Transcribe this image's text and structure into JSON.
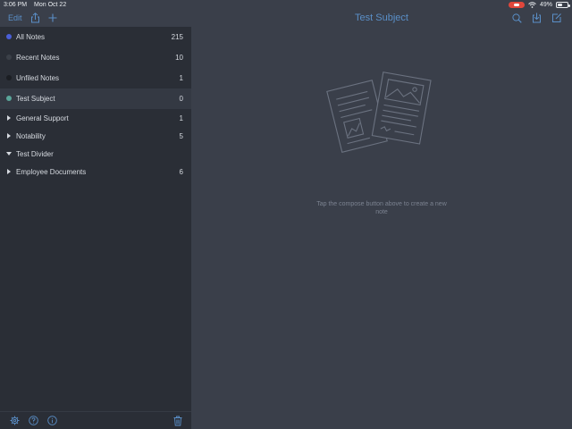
{
  "status_bar": {
    "time": "3:06 PM",
    "date": "Mon Oct 22",
    "battery": "49%",
    "battery_level": 0.49
  },
  "nav": {
    "edit_label": "Edit",
    "title": "Test Subject"
  },
  "sidebar": {
    "items": [
      {
        "label": "All Notes",
        "count": "215",
        "color": "#4a5fd8"
      },
      {
        "label": "Recent Notes",
        "count": "10",
        "color": "#3b4048"
      },
      {
        "label": "Unfiled Notes",
        "count": "1",
        "color": "#1b1e23"
      },
      {
        "label": "Test Subject",
        "count": "0",
        "color": "#5aa69a"
      }
    ],
    "groups": [
      {
        "label": "General Support",
        "count": "1",
        "expanded": false
      },
      {
        "label": "Notability",
        "count": "5",
        "expanded": false
      },
      {
        "label": "Test Divider",
        "count": "",
        "expanded": true
      },
      {
        "label": "Employee Documents",
        "count": "6",
        "expanded": false
      }
    ]
  },
  "content": {
    "empty_message": "Tap the compose button above to create a new note"
  },
  "icons": {
    "nav_left": [
      "share-icon",
      "plus-icon"
    ],
    "nav_right": [
      "search-icon",
      "import-icon",
      "compose-icon"
    ],
    "footer": [
      "gear-icon",
      "help-icon",
      "info-icon",
      "trash-icon"
    ]
  }
}
